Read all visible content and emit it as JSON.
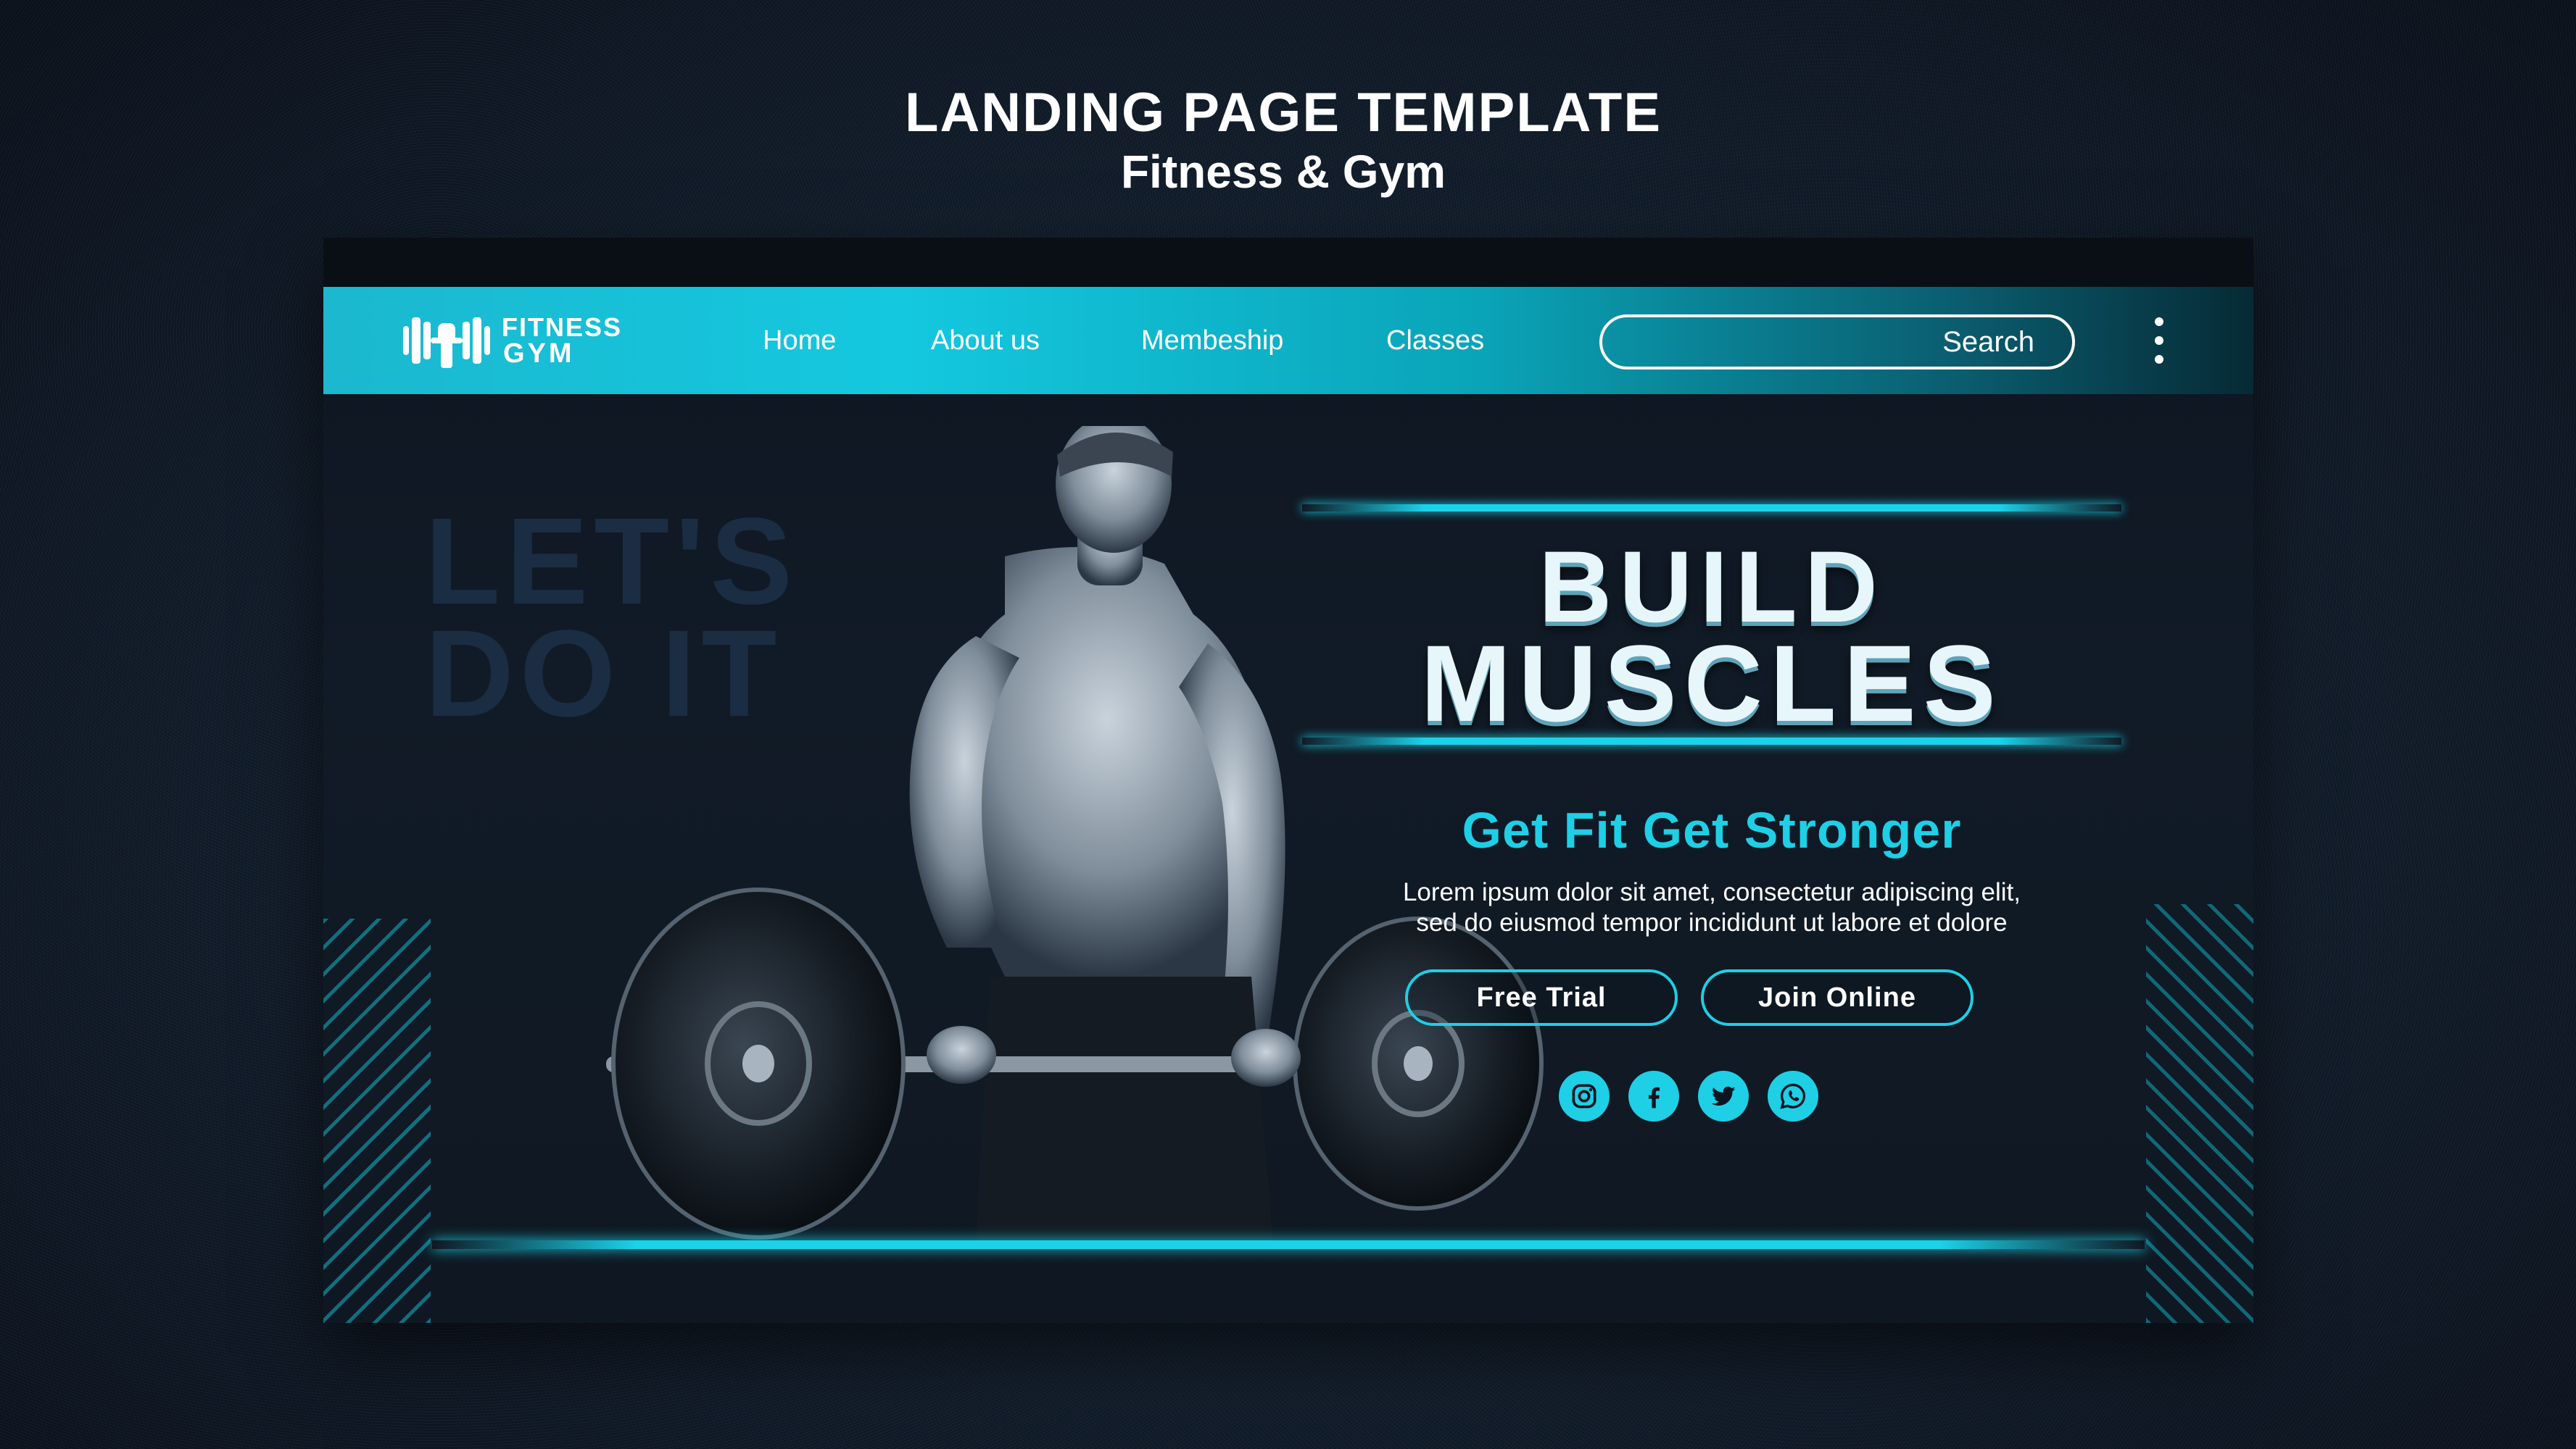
{
  "heading": {
    "title": "LANDING PAGE TEMPLATE",
    "subtitle": "Fitness & Gym"
  },
  "logo": {
    "line1": "FITNESS",
    "line2": "GYM",
    "icon": "dumbbell-fist-icon"
  },
  "nav": {
    "items": [
      {
        "label": "Home"
      },
      {
        "label": "About us"
      },
      {
        "label": "Membeship"
      },
      {
        "label": "Classes"
      }
    ],
    "search_label": "Search",
    "menu_icon": "kebab-menu-icon"
  },
  "hero": {
    "background_text_line1": "LET'S",
    "background_text_line2": "DO IT",
    "headline_line1": "BUILD",
    "headline_line2": "MUSCLES",
    "tagline": "Get Fit Get Stronger",
    "body_line1": "Lorem ipsum dolor sit amet, consectetur adipiscing elit,",
    "body_line2": "sed do eiusmod tempor incididunt ut labore et dolore",
    "buttons": {
      "free_trial": "Free Trial",
      "join_online": "Join Online"
    },
    "social_icons": [
      "instagram-icon",
      "facebook-icon",
      "twitter-icon",
      "whatsapp-icon"
    ]
  },
  "colors": {
    "accent": "#1ecfe6",
    "background": "#14202f",
    "card": "#111b27",
    "text": "#ffffff"
  }
}
